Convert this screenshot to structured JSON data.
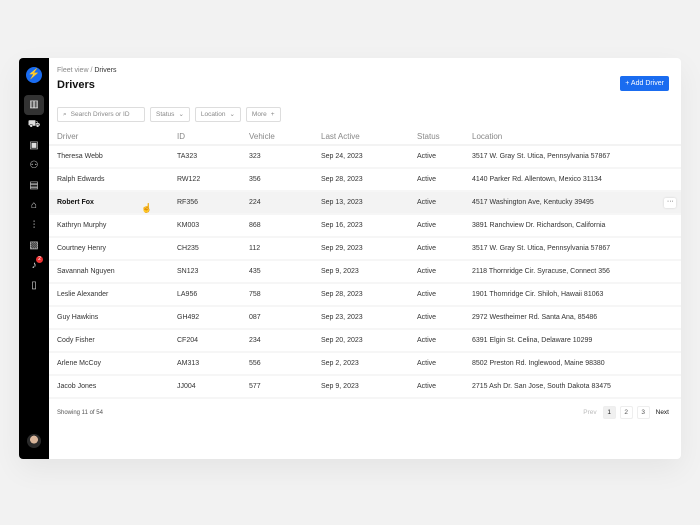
{
  "breadcrumb": {
    "parent": "Fleet view",
    "current": "Drivers"
  },
  "title": "Drivers",
  "add_button": "+ Add Driver",
  "filters": {
    "search_placeholder": "Search Drivers or ID",
    "status": "Status",
    "location": "Location",
    "more": "More"
  },
  "notifications_count": "2",
  "columns": [
    "Driver",
    "ID",
    "Vehicle",
    "Last Active",
    "Status",
    "Location"
  ],
  "rows": [
    [
      "Theresa Webb",
      "TA323",
      "323",
      "Sep 24, 2023",
      "Active",
      "3517 W. Gray St. Utica, Pennsylvania 57867"
    ],
    [
      "Ralph Edwards",
      "RW122",
      "356",
      "Sep 28, 2023",
      "Active",
      "4140 Parker Rd. Allentown,  Mexico 31134"
    ],
    [
      "Robert Fox",
      "RF356",
      "224",
      "Sep 13, 2023",
      "Active",
      "4517 Washington Ave, Kentucky 39495"
    ],
    [
      "Kathryn Murphy",
      "KM003",
      "868",
      "Sep 16, 2023",
      "Active",
      "3891 Ranchview Dr. Richardson, California"
    ],
    [
      "Courtney Henry",
      "CH235",
      "112",
      "Sep 29, 2023",
      "Active",
      "3517 W. Gray St. Utica, Pennsylvania 57867"
    ],
    [
      "Savannah Nguyen",
      "SN123",
      "435",
      "Sep 9, 2023",
      "Active",
      "2118 Thornridge Cir. Syracuse, Connect 356"
    ],
    [
      "Leslie Alexander",
      "LA956",
      "758",
      "Sep 28, 2023",
      "Active",
      "1901 Thornridge Cir. Shiloh, Hawaii 81063"
    ],
    [
      "Guy Hawkins",
      "GH492",
      "087",
      "Sep 23, 2023",
      "Active",
      "2972 Westheimer Rd. Santa Ana,  85486"
    ],
    [
      "Cody Fisher",
      "CF204",
      "234",
      "Sep 20, 2023",
      "Active",
      "6391 Elgin St. Celina, Delaware 10299"
    ],
    [
      "Arlene McCoy",
      "AM313",
      "556",
      "Sep 2, 2023",
      "Active",
      "8502 Preston Rd. Inglewood, Maine 98380"
    ],
    [
      "Jacob Jones",
      "JJ004",
      "577",
      "Sep 9, 2023",
      "Active",
      "2715 Ash Dr. San Jose, South Dakota 83475"
    ]
  ],
  "row_actions": "···",
  "showing": "Showing 11 of 54",
  "pagination": {
    "prev": "Prev",
    "pages": [
      "1",
      "2",
      "3"
    ],
    "next": "Next"
  }
}
